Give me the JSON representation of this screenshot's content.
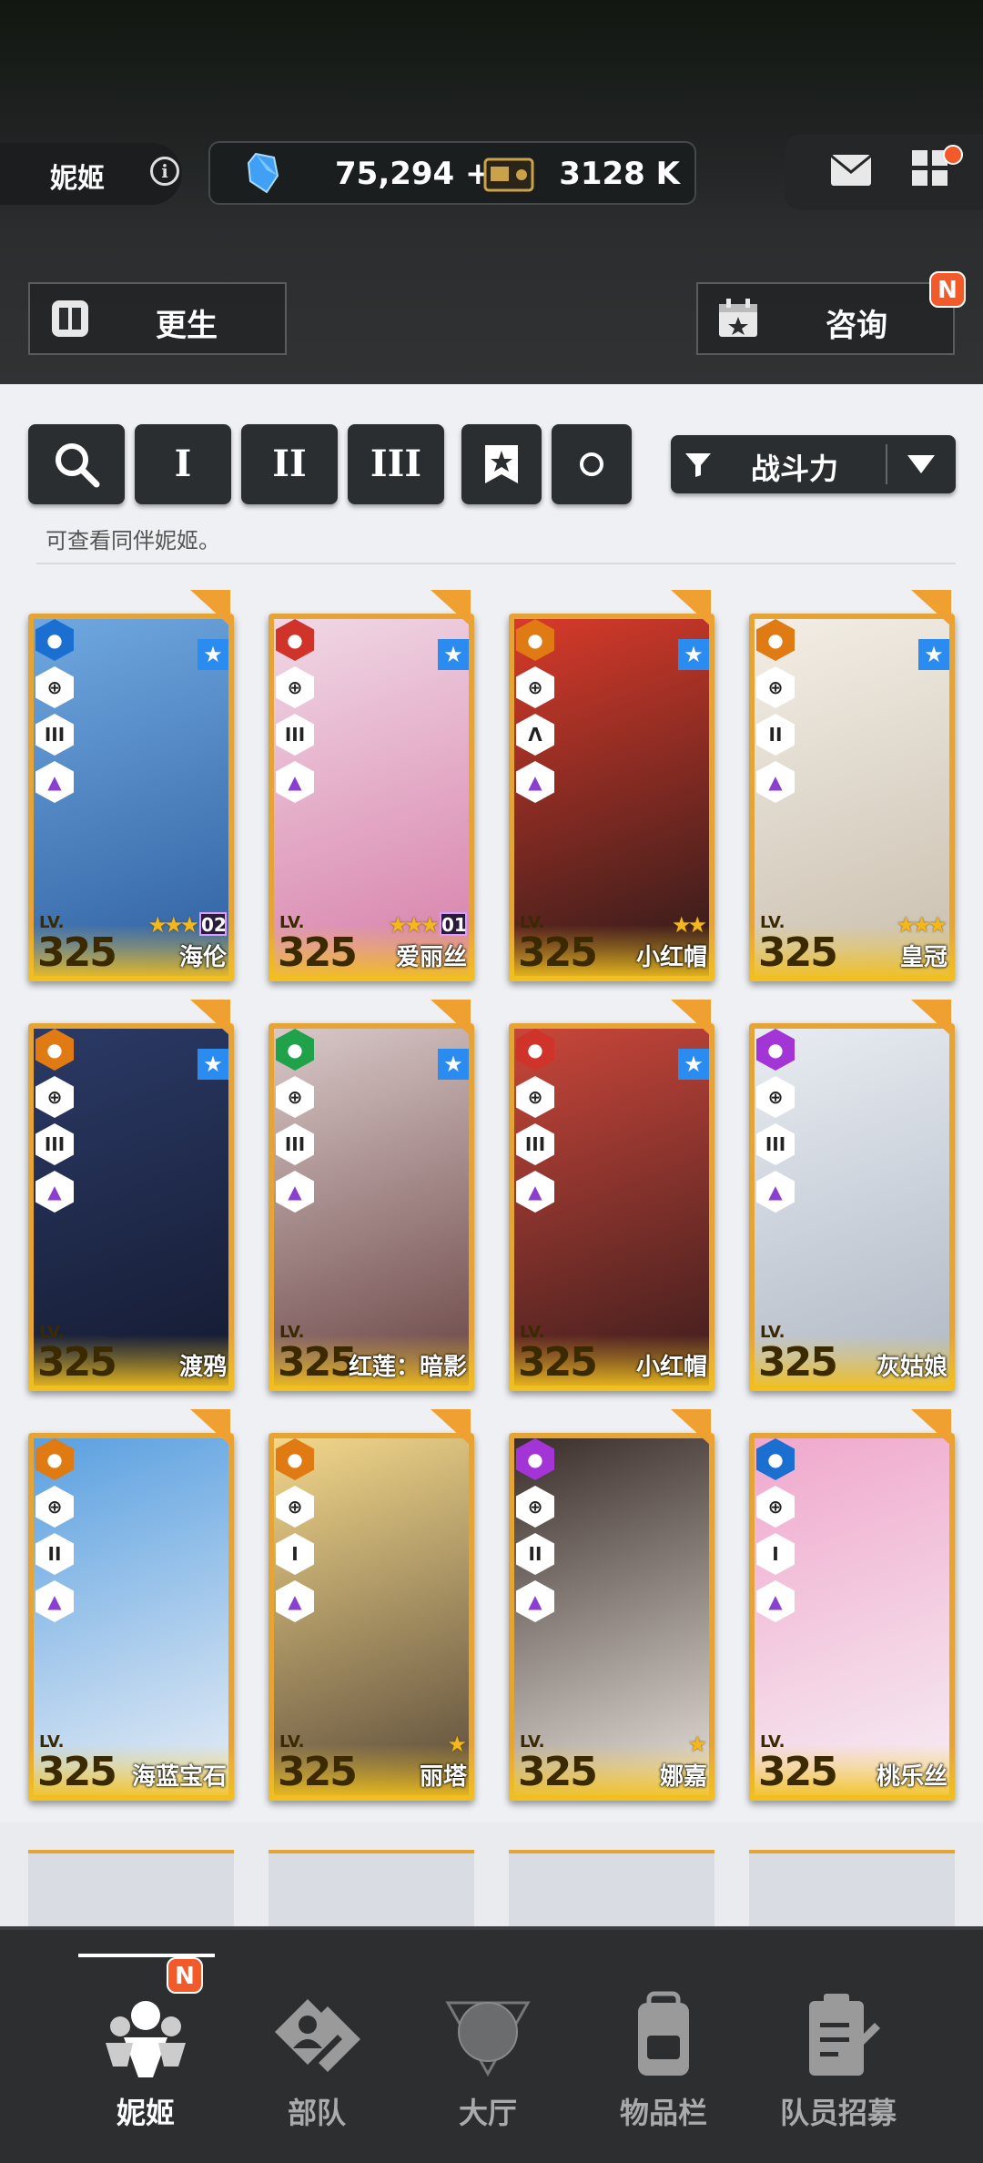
{
  "header": {
    "player_name": "妮姬",
    "gems": "75,294",
    "gems_add": "+",
    "credits": "3128 K",
    "rebirth_label": "更生",
    "consult_label": "咨询",
    "new_badge": "N"
  },
  "filters": {
    "search": "search-icon",
    "burst_1": "I",
    "burst_2": "II",
    "burst_3": "III",
    "sort_label": "战斗力",
    "hint": "可查看同伴妮姬。"
  },
  "characters": [
    {
      "name": "海伦",
      "level": "325",
      "burst": "III",
      "limit": "02",
      "stars": "★★★",
      "element_color": "#1b6fd1"
    },
    {
      "name": "爱丽丝",
      "level": "325",
      "burst": "III",
      "limit": "01",
      "stars": "★★★",
      "element_color": "#d0332a"
    },
    {
      "name": "小红帽",
      "level": "325",
      "burst": "Λ",
      "limit": "",
      "stars": "★★",
      "element_color": "#e07a12"
    },
    {
      "name": "皇冠",
      "level": "325",
      "burst": "II",
      "limit": "",
      "stars": "★★★",
      "element_color": "#e07a12"
    },
    {
      "name": "渡鸦",
      "level": "325",
      "burst": "III",
      "limit": "",
      "stars": "",
      "element_color": "#e07a12"
    },
    {
      "name": "红莲：暗影",
      "level": "325",
      "burst": "III",
      "limit": "",
      "stars": "",
      "element_color": "#1fa24a"
    },
    {
      "name": "小红帽",
      "level": "325",
      "burst": "III",
      "limit": "",
      "stars": "",
      "element_color": "#d0332a"
    },
    {
      "name": "灰姑娘",
      "level": "325",
      "burst": "III",
      "limit": "",
      "stars": "",
      "element_color": "#a334d6"
    },
    {
      "name": "海蓝宝石",
      "level": "325",
      "burst": "II",
      "limit": "",
      "stars": "",
      "element_color": "#e07a12"
    },
    {
      "name": "丽塔",
      "level": "325",
      "burst": "I",
      "limit": "",
      "stars": "★",
      "element_color": "#e07a12"
    },
    {
      "name": "娜嘉",
      "level": "325",
      "burst": "II",
      "limit": "",
      "stars": "★",
      "element_color": "#a334d6"
    },
    {
      "name": "桃乐丝",
      "level": "325",
      "burst": "I",
      "limit": "",
      "stars": "",
      "element_color": "#1b6fd1"
    }
  ],
  "lv_label": "LV.",
  "nav": {
    "nikke": "妮姬",
    "squad": "部队",
    "lobby": "大厅",
    "inventory": "物品栏",
    "recruit": "队员招募"
  }
}
